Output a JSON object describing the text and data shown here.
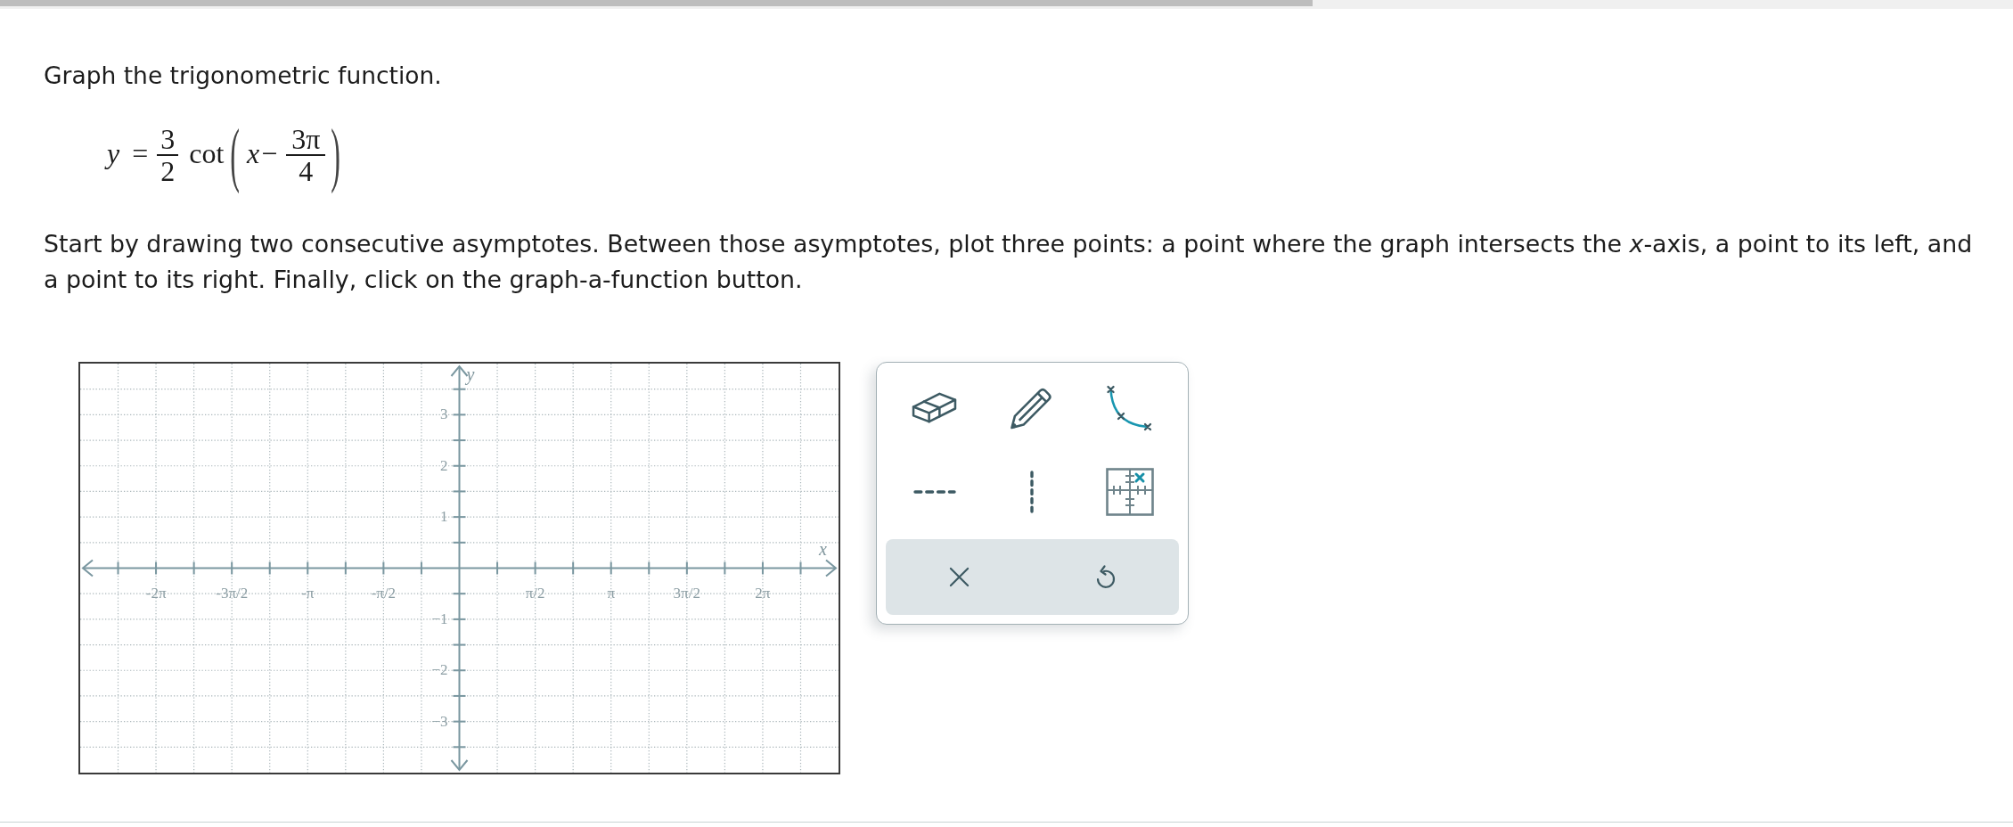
{
  "progress": {
    "level": 0.652
  },
  "question": {
    "title": "Graph the trigonometric function.",
    "formula": {
      "lhs": "y",
      "relation": "=",
      "coefficient": {
        "numerator": "3",
        "denominator": "2"
      },
      "function": "cot",
      "open": "(",
      "variable": "x",
      "operator": "−",
      "shift": {
        "numerator": "3π",
        "denominator": "4"
      },
      "close": ")"
    },
    "instructions": "Start by drawing two consecutive asymptotes. Between those asymptotes, plot three points: a point where the graph intersects the *x*-axis, a point to its left, and a point to its right. Finally, click on the graph-a-function button."
  },
  "graph": {
    "chart_data": {
      "type": "line",
      "grid": true,
      "xlabel": "x",
      "ylabel": "y",
      "xlim": [
        -7.854,
        7.854
      ],
      "ylim": [
        -4,
        4
      ],
      "xticks": [
        {
          "value": -6.283,
          "label": "-2π"
        },
        {
          "value": -4.712,
          "label": "-3π/2"
        },
        {
          "value": -3.142,
          "label": "-π"
        },
        {
          "value": -1.571,
          "label": "-π/2"
        },
        {
          "value": 1.571,
          "label": "π/2"
        },
        {
          "value": 3.142,
          "label": "π"
        },
        {
          "value": 4.712,
          "label": "3π/2"
        },
        {
          "value": 6.283,
          "label": "2π"
        }
      ],
      "yticks": [
        {
          "value": 3,
          "label": "3"
        },
        {
          "value": 2,
          "label": "2"
        },
        {
          "value": 1,
          "label": "1"
        },
        {
          "value": -1,
          "label": "−1"
        },
        {
          "value": -2,
          "label": "−2"
        },
        {
          "value": -3,
          "label": "−3"
        }
      ]
    }
  },
  "tool_panel": {
    "tools": [
      {
        "kind": "eraser"
      },
      {
        "kind": "pencil"
      },
      {
        "kind": "curve"
      },
      {
        "kind": "hline"
      },
      {
        "kind": "vline"
      },
      {
        "kind": "point"
      }
    ],
    "actions": [
      {
        "kind": "clear"
      },
      {
        "kind": "undo"
      }
    ]
  }
}
